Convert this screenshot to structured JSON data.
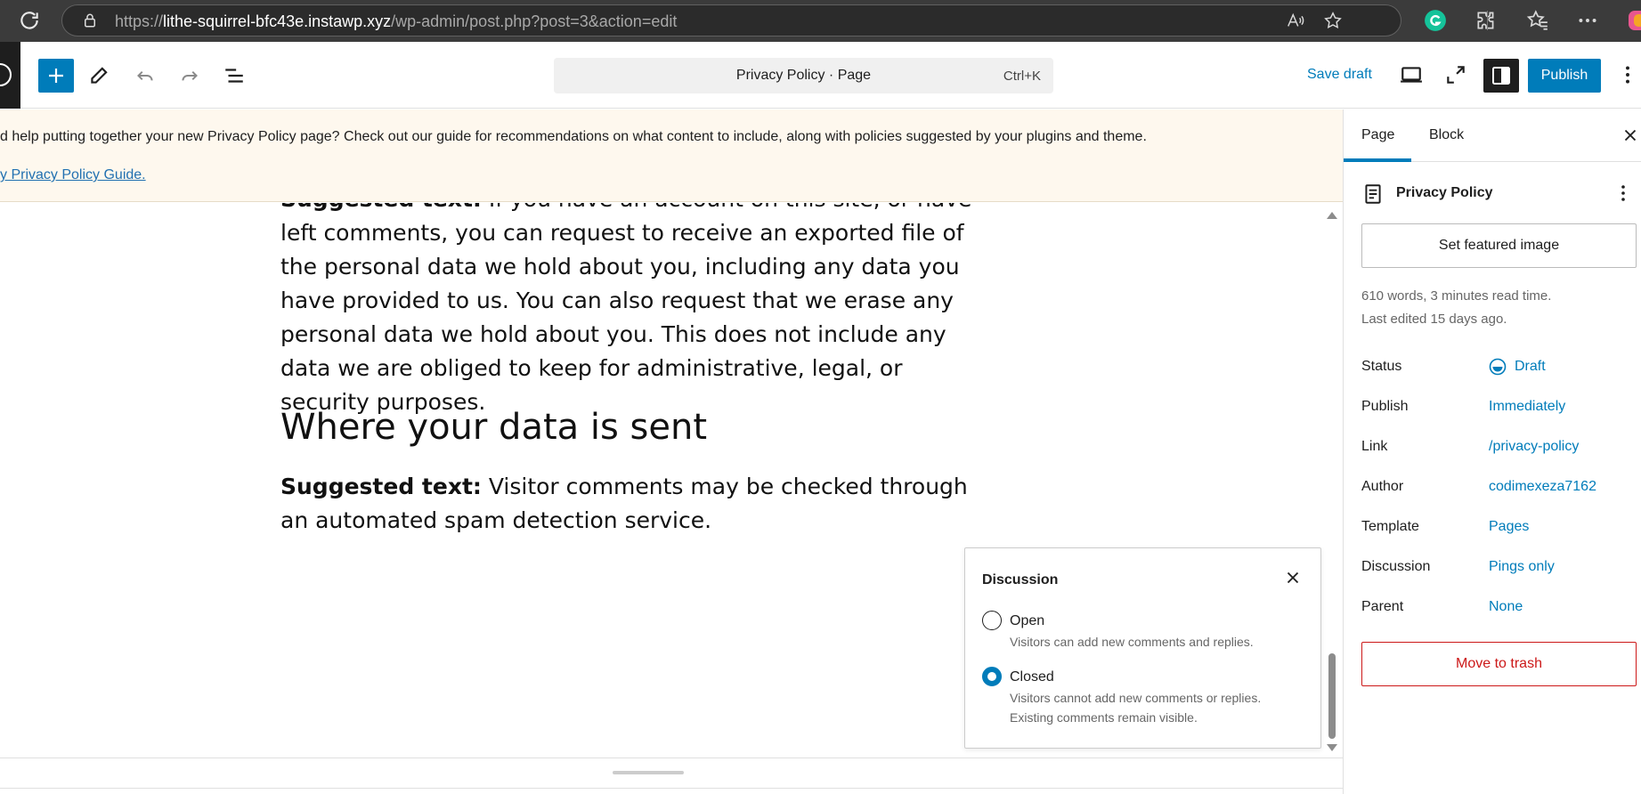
{
  "browser": {
    "url_scheme": "https://",
    "url_host": "lithe-squirrel-bfc43e.instawp.xyz",
    "url_path": "/wp-admin/post.php?post=3&action=edit",
    "icons": [
      "reload-icon",
      "lock-icon",
      "read-aloud-icon",
      "favorite-icon",
      "grammarly-icon",
      "extensions-icon",
      "favorites-icon",
      "more-icon"
    ]
  },
  "toolbar": {
    "command_title": "Privacy Policy · Page",
    "command_shortcut": "Ctrl+K",
    "save_draft": "Save draft",
    "publish": "Publish"
  },
  "notice": {
    "text": "d help putting together your new Privacy Policy page? Check out our guide for recommendations on what content to include, along with policies suggested by your plugins and theme.",
    "link": "y Privacy Policy Guide."
  },
  "content": {
    "para1_label": "Suggested text:",
    "para1_text": " If you have an account on this site, or have left comments, you can request to receive an exported file of the personal data we hold about you, including any data you have provided to us. You can also request that we erase any personal data we hold about you. This does not include any data we are obliged to keep for administrative, legal, or security purposes.",
    "heading": "Where your data is sent",
    "para2_label": "Suggested text:",
    "para2_text": " Visitor comments may be checked through an automated spam detection service."
  },
  "discussion_popover": {
    "title": "Discussion",
    "options": [
      {
        "label": "Open",
        "help": "Visitors can add new comments and replies.",
        "checked": false
      },
      {
        "label": "Closed",
        "help": "Visitors cannot add new comments or replies. Existing comments remain visible.",
        "checked": true
      }
    ]
  },
  "sidebar": {
    "tabs": [
      "Page",
      "Block"
    ],
    "active_tab": "Page",
    "doc_title": "Privacy Policy",
    "featured_image": "Set featured image",
    "word_count": "610 words, 3 minutes read time.",
    "last_edited": "Last edited 15 days ago.",
    "rows": [
      {
        "label": "Status",
        "value": "Draft"
      },
      {
        "label": "Publish",
        "value": "Immediately"
      },
      {
        "label": "Link",
        "value": "/privacy-policy"
      },
      {
        "label": "Author",
        "value": "codimexeza7162"
      },
      {
        "label": "Template",
        "value": "Pages"
      },
      {
        "label": "Discussion",
        "value": "Pings only"
      },
      {
        "label": "Parent",
        "value": "None"
      }
    ],
    "move_to_trash": "Move to trash"
  },
  "colors": {
    "accent": "#007cba",
    "danger": "#cc1818",
    "notice_bg": "#fef8ee"
  }
}
